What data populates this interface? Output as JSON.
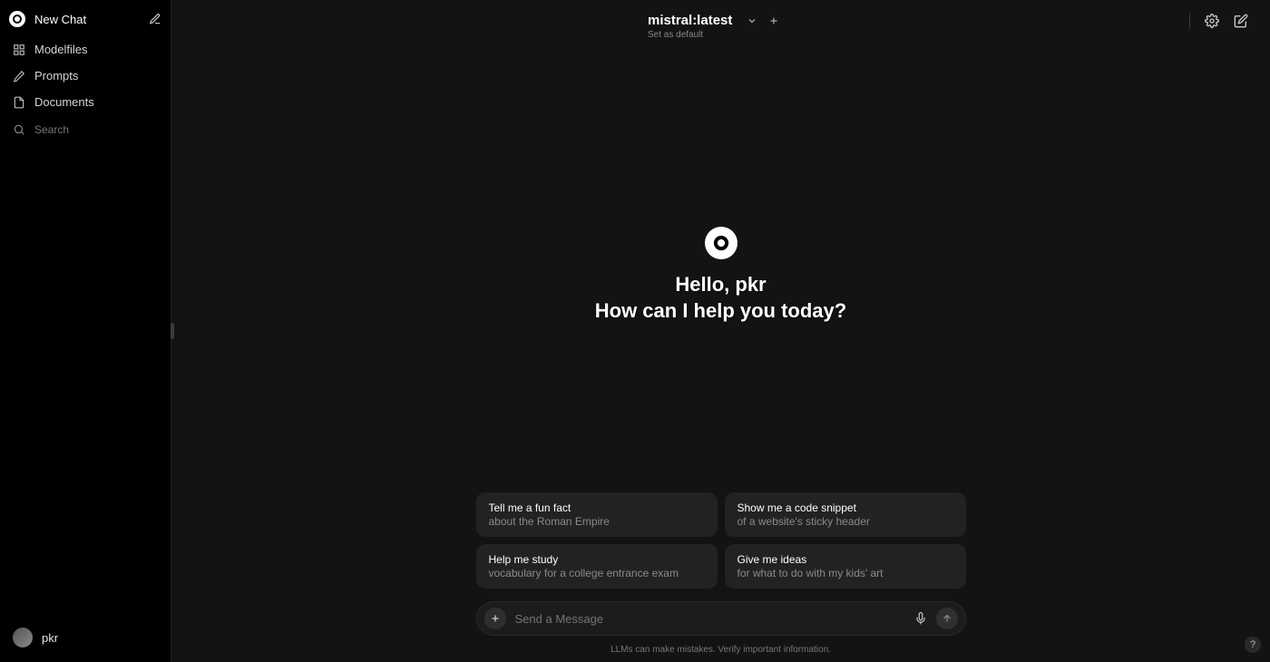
{
  "sidebar": {
    "new_chat": "New Chat",
    "items": [
      {
        "label": "Modelfiles"
      },
      {
        "label": "Prompts"
      },
      {
        "label": "Documents"
      }
    ],
    "search_placeholder": "Search",
    "username": "pkr"
  },
  "topbar": {
    "model_name": "mistral:latest",
    "set_default": "Set as default"
  },
  "center": {
    "greeting_line1": "Hello, pkr",
    "greeting_line2": "How can I help you today?"
  },
  "suggestions": [
    {
      "title": "Tell me a fun fact",
      "sub": "about the Roman Empire"
    },
    {
      "title": "Show me a code snippet",
      "sub": "of a website's sticky header"
    },
    {
      "title": "Help me study",
      "sub": "vocabulary for a college entrance exam"
    },
    {
      "title": "Give me ideas",
      "sub": "for what to do with my kids' art"
    }
  ],
  "input": {
    "placeholder": "Send a Message"
  },
  "disclaimer": "LLMs can make mistakes. Verify important information.",
  "help": "?"
}
